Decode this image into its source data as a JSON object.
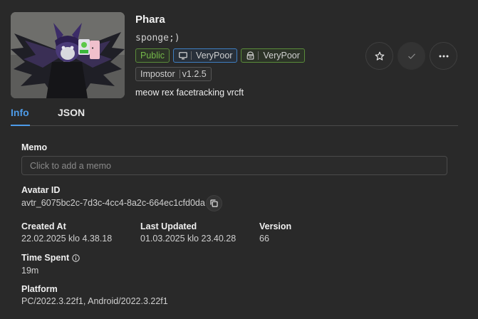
{
  "header": {
    "title": "Phara",
    "author": "sponge;)",
    "tags": {
      "visibility": "Public",
      "pc_performance": "VeryPoor",
      "android_performance": "VeryPoor",
      "impostor": "Impostor",
      "impostor_version": "v1.2.5"
    },
    "description": "meow rex facetracking vrcft"
  },
  "tabs": [
    {
      "label": "Info"
    },
    {
      "label": "JSON"
    }
  ],
  "info": {
    "memo_label": "Memo",
    "memo_placeholder": "Click to add a memo",
    "avatar_id_label": "Avatar ID",
    "avatar_id": "avtr_6075bc2c-7d3c-4cc4-8a2c-664ec1cfd0da",
    "created_label": "Created At",
    "created_value": "22.02.2025 klo 4.38.18",
    "updated_label": "Last Updated",
    "updated_value": "01.03.2025 klo 23.40.28",
    "version_label": "Version",
    "version_value": "66",
    "time_spent_label": "Time Spent",
    "time_spent_value": "19m",
    "platform_label": "Platform",
    "platform_value": "PC/2022.3.22f1, Android/2022.3.22f1"
  },
  "colors": {
    "background": "#292929",
    "accent": "#4d9be8",
    "public_green": "#75b94a",
    "pc_border_blue": "#3f7fc2",
    "android_border_green": "#5a8c3a"
  },
  "icons": {
    "pc": "monitor-icon",
    "android": "android-icon",
    "favorite": "star-icon",
    "select": "check-icon",
    "more": "more-horizontal-icon",
    "copy": "copy-icon",
    "info": "info-circle-icon"
  }
}
